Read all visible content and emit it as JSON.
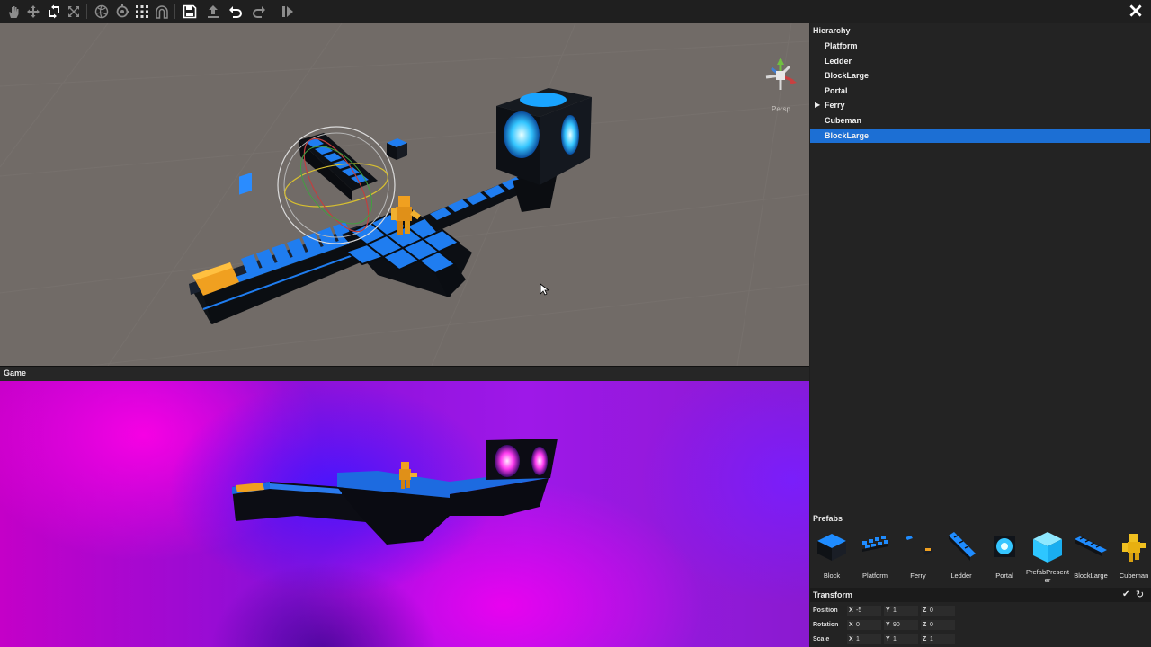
{
  "toolbar": {
    "tools": [
      {
        "name": "hand-icon"
      },
      {
        "name": "move-icon"
      },
      {
        "name": "rotate-icon"
      },
      {
        "name": "scale-icon"
      },
      {
        "name": "globe-icon"
      },
      {
        "name": "pivot-icon"
      },
      {
        "name": "grid-icon"
      },
      {
        "name": "magnet-icon"
      },
      {
        "name": "save-icon"
      },
      {
        "name": "upload-icon"
      },
      {
        "name": "undo-icon"
      },
      {
        "name": "redo-icon"
      },
      {
        "name": "play-icon"
      }
    ],
    "close_icon": "close-icon"
  },
  "scene": {
    "persp_label": "Persp",
    "background": "#716b67"
  },
  "game": {
    "title": "Game"
  },
  "hierarchy": {
    "title": "Hierarchy",
    "items": [
      {
        "label": "Platform",
        "expandable": false,
        "selected": false
      },
      {
        "label": "Ledder",
        "expandable": false,
        "selected": false
      },
      {
        "label": "BlockLarge",
        "expandable": false,
        "selected": false
      },
      {
        "label": "Portal",
        "expandable": false,
        "selected": false
      },
      {
        "label": "Ferry",
        "expandable": true,
        "selected": false
      },
      {
        "label": "Cubeman",
        "expandable": false,
        "selected": false
      },
      {
        "label": "BlockLarge",
        "expandable": false,
        "selected": true
      }
    ],
    "selection_color": "#1c6fd4"
  },
  "prefabs": {
    "title": "Prefabs",
    "items": [
      {
        "label": "Block",
        "icon": "block-icon"
      },
      {
        "label": "Platform",
        "icon": "platform-icon"
      },
      {
        "label": "Ferry",
        "icon": "ferry-icon"
      },
      {
        "label": "Ledder",
        "icon": "ledder-icon"
      },
      {
        "label": "Portal",
        "icon": "portal-icon"
      },
      {
        "label": "PrefabPresenter",
        "icon": "prefab-presenter-icon"
      },
      {
        "label": "BlockLarge",
        "icon": "block-large-icon"
      },
      {
        "label": "Cubeman",
        "icon": "cubeman-icon"
      }
    ]
  },
  "transform": {
    "title": "Transform",
    "position": {
      "label": "Position",
      "x": "-5",
      "y": "1",
      "z": "0"
    },
    "rotation": {
      "label": "Rotation",
      "x": "0",
      "y": "90",
      "z": "0"
    },
    "scale": {
      "label": "Scale",
      "x": "1",
      "y": "1",
      "z": "1"
    }
  },
  "colors": {
    "accent_blue": "#1e7cf0",
    "cubeman_orange": "#f0a020"
  }
}
